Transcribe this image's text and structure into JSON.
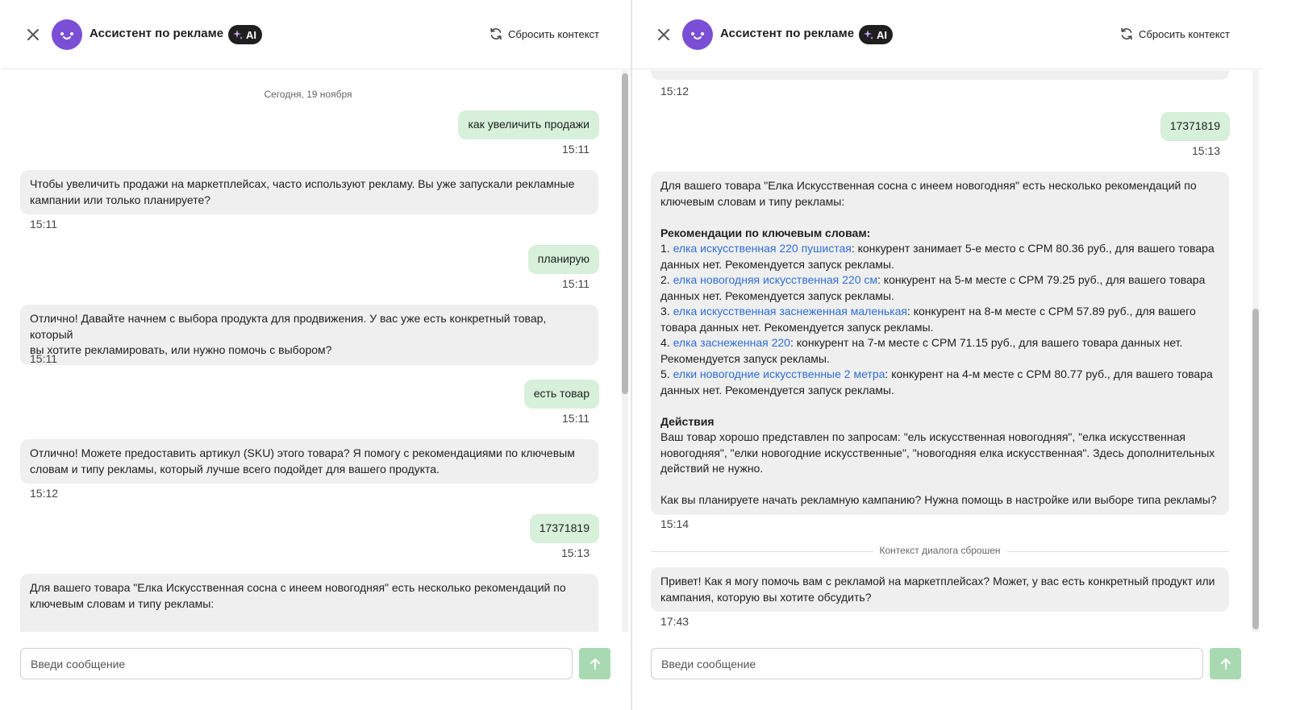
{
  "app": {
    "title": "Ассистент по рекламе",
    "ai_badge": "AI",
    "reset_label": "Сбросить контекст",
    "input_placeholder": "Введи сообщение",
    "colors": {
      "user_bubble": "#d6f0da",
      "bot_bubble": "#efefef",
      "avatar": "#7a4fd6",
      "send_button": "#a8d9b1",
      "link": "#2f6fd1"
    }
  },
  "left": {
    "date_label": "Сегодня, 19 ноября",
    "messages": [
      {
        "role": "user",
        "text": "как увеличить продажи",
        "time": "15:11"
      },
      {
        "role": "bot",
        "line1": "Чтобы увеличить продажи на маркетплейсах, часто используют рекламу. Вы уже запускали рекламные",
        "line2": "кампании или только планируете?",
        "time": "15:11"
      },
      {
        "role": "user",
        "text": "планирую",
        "time": "15:11"
      },
      {
        "role": "bot",
        "line1": "Отлично! Давайте начнем с выбора продукта для продвижения. У вас уже есть конкретный товар, который",
        "line2": "вы хотите рекламировать, или нужно помочь с выбором?",
        "time": "15:11"
      },
      {
        "role": "user",
        "text": "есть товар",
        "time": "15:11"
      },
      {
        "role": "bot",
        "line1": "Отлично! Можете предоставить артикул (SKU) этого товара? Я помогу с рекомендациями по ключевым",
        "line2": "словам и типу рекламы, который лучше всего подойдет для вашего продукта.",
        "time": "15:12"
      },
      {
        "role": "user",
        "text": "17371819",
        "time": "15:13"
      },
      {
        "role": "bot",
        "line1": "Для вашего товара \"Елка Искусственная сосна с инеем новогодняя\" есть несколько рекомендаций по",
        "line2": "ключевым словам и типу рекламы:"
      }
    ]
  },
  "right": {
    "top_time": "15:12",
    "user_msg": {
      "text": "17371819",
      "time": "15:13"
    },
    "long_msg": {
      "intro1": "Для вашего товара \"Елка Искусственная сосна с инеем новогодняя\" есть несколько рекомендаций по",
      "intro2": "ключевым словам и типу рекламы:",
      "kw_heading": "Рекомендации по ключевым словам:",
      "items": [
        {
          "num": "1. ",
          "kw": "елка искусственная 220 пушистая",
          "rest1": ": конкурент занимает 5-е место с CPM 80.36 руб., для вашего товара",
          "rest2": "данных нет. Рекомендуется запуск рекламы."
        },
        {
          "num": "2. ",
          "kw": "елка новогодняя искусственная 220 см",
          "rest1": ": конкурент на 5-м месте с CPM 79.25 руб., для вашего товара",
          "rest2": "данных нет. Рекомендуется запуск рекламы."
        },
        {
          "num": "3. ",
          "kw": "елка искусственная заснеженная маленькая",
          "rest1": ": конкурент на 8-м месте с CPM 57.89 руб., для вашего",
          "rest2": "товара данных нет. Рекомендуется запуск рекламы."
        },
        {
          "num": "4. ",
          "kw": "елка заснеженная 220",
          "rest1": ": конкурент на 7-м месте с CPM 71.15 руб., для вашего товара данных нет.",
          "rest2": "Рекомендуется запуск рекламы."
        },
        {
          "num": "5. ",
          "kw": "елки новогодние искусственные 2 метра",
          "rest1": ": конкурент на 4-м месте с CPM 80.77 руб., для вашего товара",
          "rest2": "данных нет. Рекомендуется запуск рекламы."
        }
      ],
      "actions_heading": "Действия",
      "actions1": "Ваш товар хорошо представлен по запросам: \"ель искусственная новогодняя\", \"елка искусственная",
      "actions2": "новогодняя\", \"елки новогодние искусственные\", \"новогодняя елка искусственная\". Здесь дополнительных",
      "actions3": "действий не нужно.",
      "question": "Как вы планируете начать рекламную кампанию? Нужна помощь в настройке или выборе типа рекламы?",
      "time": "15:14"
    },
    "context_reset_label": "Контекст диалога сброшен",
    "last_msg": {
      "line1": "Привет! Как я могу помочь вам с рекламой на маркетплейсах? Может, у вас есть конкретный продукт или",
      "line2": "кампания, которую вы хотите обсудить?",
      "time": "17:43"
    }
  }
}
